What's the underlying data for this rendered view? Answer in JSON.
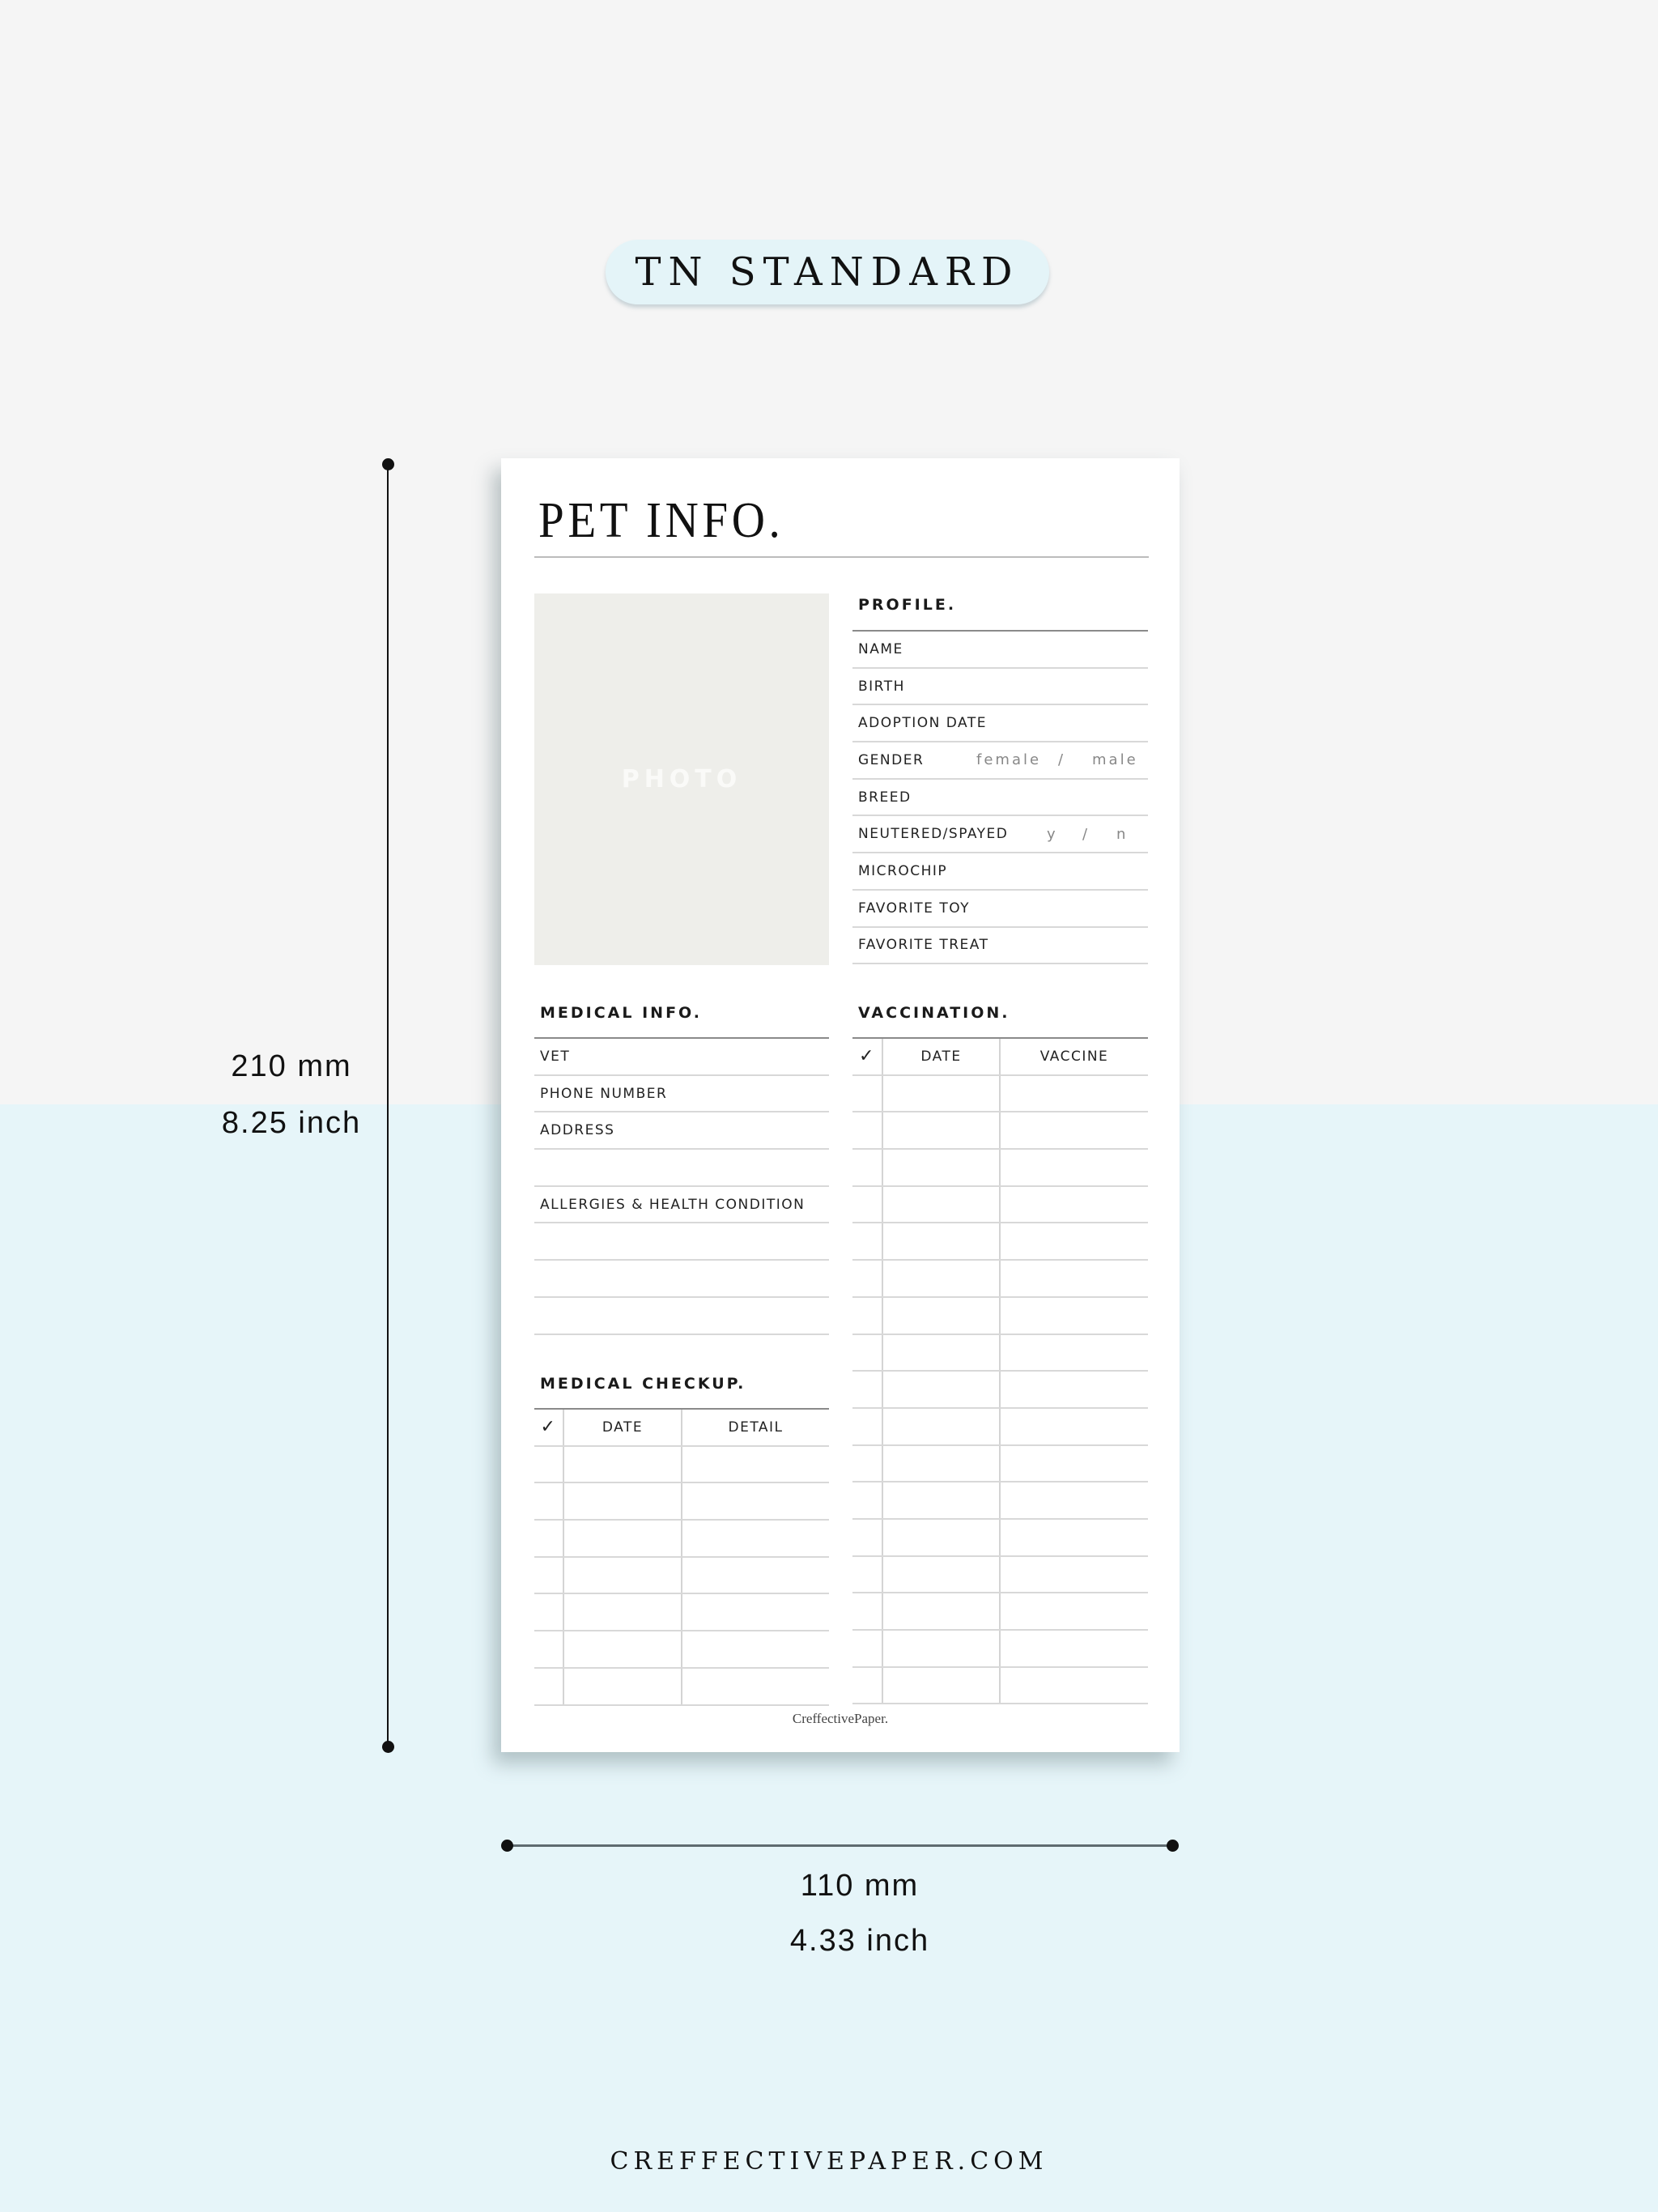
{
  "size_badge": {
    "label": "TN STANDARD"
  },
  "dimensions": {
    "height_mm": "210 mm",
    "height_inch": "8.25 inch",
    "width_mm": "110 mm",
    "width_inch": "4.33 inch"
  },
  "page": {
    "title": "PET INFO.",
    "photo_label": "PHOTO",
    "profile": {
      "heading": "PROFILE.",
      "fields": [
        {
          "label": "NAME"
        },
        {
          "label": "BIRTH"
        },
        {
          "label": "ADOPTION DATE"
        },
        {
          "label": "GENDER",
          "options": [
            "female",
            "/",
            "male"
          ]
        },
        {
          "label": "BREED"
        },
        {
          "label": "NEUTERED/SPAYED",
          "options": [
            "y",
            "/",
            "n"
          ]
        },
        {
          "label": "MICROCHIP"
        },
        {
          "label": "FAVORITE TOY"
        },
        {
          "label": "FAVORITE TREAT"
        }
      ]
    },
    "medical_info": {
      "heading": "MEDICAL INFO.",
      "fields": [
        {
          "label": "VET"
        },
        {
          "label": "PHONE NUMBER"
        },
        {
          "label": "ADDRESS"
        },
        {
          "label": ""
        },
        {
          "label": "ALLERGIES & HEALTH CONDITION"
        },
        {
          "label": ""
        },
        {
          "label": ""
        },
        {
          "label": ""
        }
      ]
    },
    "vaccination": {
      "heading": "VACCINATION.",
      "columns": [
        "✓",
        "DATE",
        "VACCINE"
      ],
      "row_count": 17
    },
    "medical_checkup": {
      "heading": "MEDICAL CHECKUP.",
      "columns": [
        "✓",
        "DATE",
        "DETAIL"
      ],
      "row_count": 7
    },
    "brand": "CreffectivePaper."
  },
  "footer": {
    "website": "CREFFECTIVEPAPER.COM"
  },
  "colors": {
    "top_background": "#f5f5f5",
    "bottom_background": "#e6f5f9",
    "badge": "#e4f4f8",
    "photo_placeholder": "#eeeeea"
  }
}
